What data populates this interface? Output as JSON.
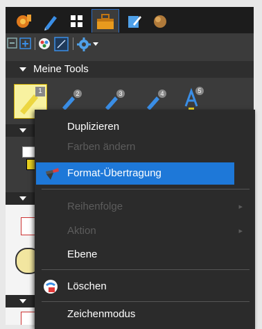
{
  "section": {
    "title": "Meine Tools"
  },
  "tool_badges": [
    "1",
    "2",
    "3",
    "4",
    "5"
  ],
  "context_menu": {
    "items": [
      {
        "label": "Duplizieren",
        "enabled": true
      },
      {
        "label": "Farben ändern",
        "enabled": false
      },
      {
        "label": "Format-Übertragung",
        "enabled": true,
        "highlighted": true,
        "icon": "brush-icon"
      },
      {
        "label": "Reihenfolge",
        "enabled": false,
        "submenu": true
      },
      {
        "label": "Aktion",
        "enabled": false,
        "submenu": true
      },
      {
        "label": "Ebene",
        "enabled": true
      },
      {
        "label": "Löschen",
        "enabled": true,
        "icon": "delete-icon"
      },
      {
        "label": "Zeichenmodus",
        "enabled": true
      }
    ]
  },
  "colors": {
    "accent": "#1e78d8",
    "menu_bg": "#2b2b2b",
    "toolbar_bg": "#3b3b3b"
  }
}
